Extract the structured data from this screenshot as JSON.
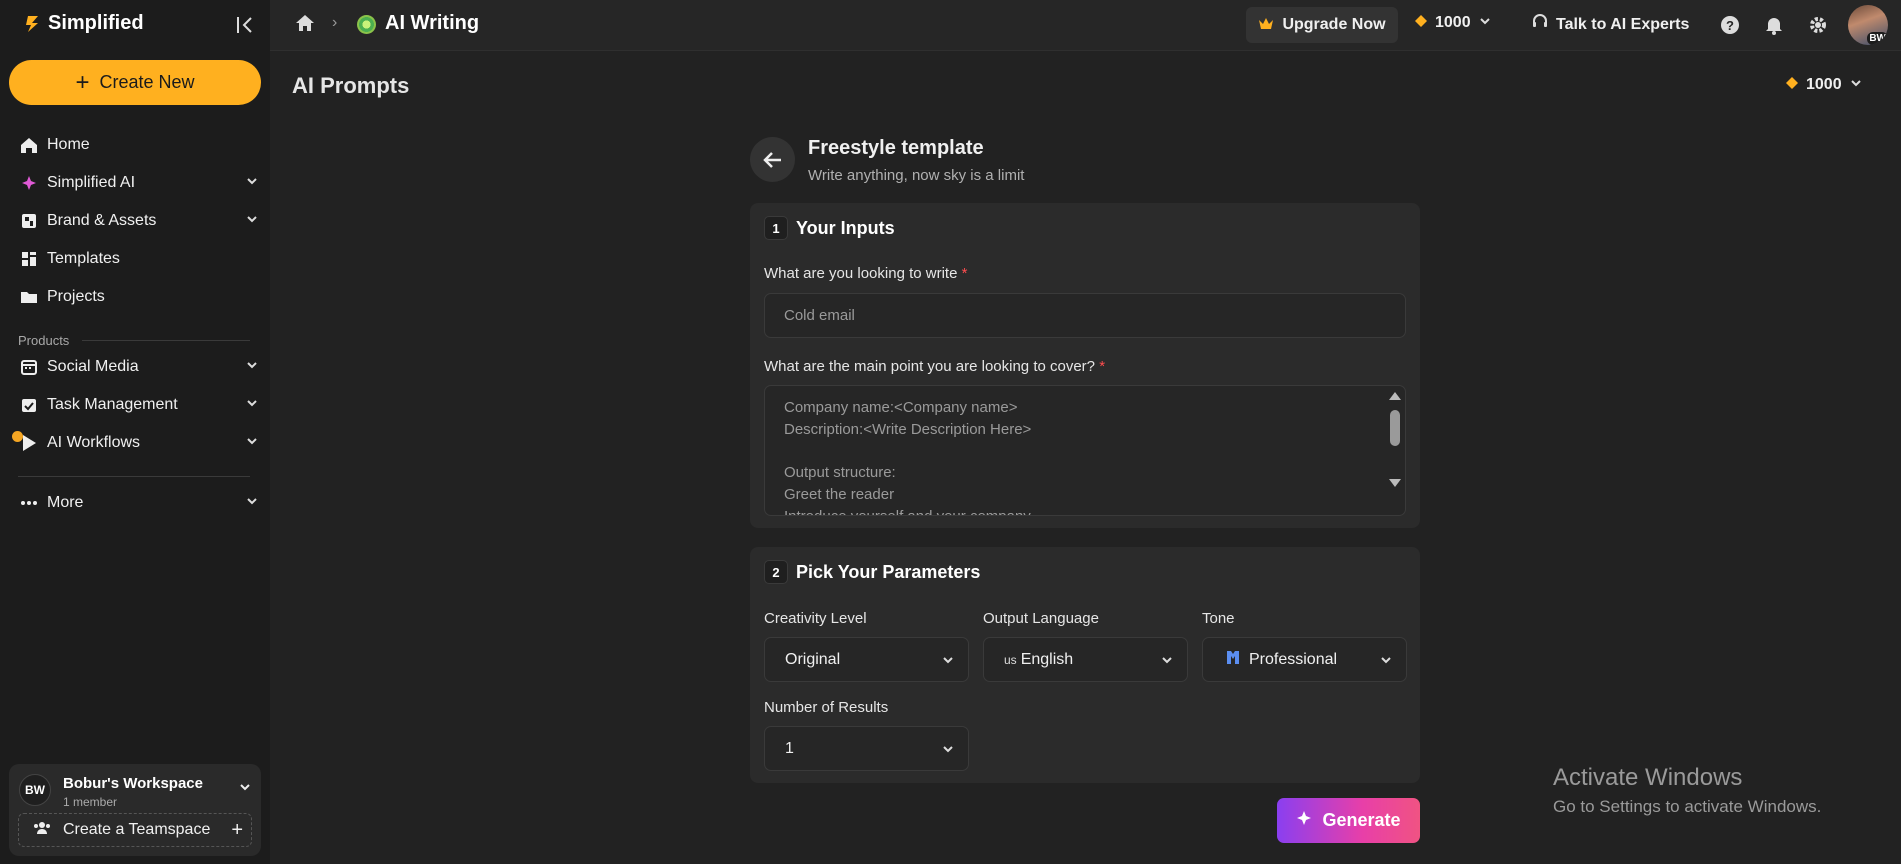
{
  "sidebar": {
    "logo_text": "Simplified",
    "create_label": "Create New",
    "nav_main": [
      {
        "label": "Home",
        "icon": "home-icon"
      },
      {
        "label": "Simplified AI",
        "icon": "sparkle-icon"
      },
      {
        "label": "Brand & Assets",
        "icon": "brand-icon"
      },
      {
        "label": "Templates",
        "icon": "templates-icon"
      },
      {
        "label": "Projects",
        "icon": "folder-icon"
      }
    ],
    "products_label": "Products",
    "nav_products": [
      {
        "label": "Social Media",
        "icon": "calendar-icon"
      },
      {
        "label": "Task Management",
        "icon": "task-icon"
      },
      {
        "label": "AI Workflows",
        "icon": "play-icon"
      }
    ],
    "more_label": "More",
    "workspace": {
      "initials": "BW",
      "name": "Bobur's Workspace",
      "members": "1 member",
      "teamspace_label": "Create a Teamspace"
    }
  },
  "topbar": {
    "app_title": "AI Writing",
    "upgrade_label": "Upgrade Now",
    "credits": "1000",
    "talk_label": "Talk to AI Experts",
    "avatar_initials": "BW"
  },
  "main": {
    "page_title": "AI Prompts",
    "credits": "1000",
    "template_title": "Freestyle template",
    "template_subtitle": "Write anything, now sky is a limit",
    "inputs": {
      "step": "1",
      "title": "Your Inputs",
      "q1_label": "What are you looking to write",
      "q1_placeholder": "Cold email",
      "q2_label": "What are the main point you are looking to cover?",
      "q2_placeholder": "Company name:<Company name>\nDescription:<Write Description Here>\n\nOutput structure:\nGreet the reader\nIntroduce yourself and your company"
    },
    "params": {
      "step": "2",
      "title": "Pick Your Parameters",
      "creativity_label": "Creativity Level",
      "creativity_value": "Original",
      "language_label": "Output Language",
      "language_flag": "us",
      "language_value": "English",
      "tone_label": "Tone",
      "tone_value": "Professional",
      "results_label": "Number of Results",
      "results_value": "1"
    },
    "generate_label": "Generate"
  },
  "overlay": {
    "title": "Activate Windows",
    "subtitle": "Go to Settings to activate Windows."
  },
  "colors": {
    "accent": "#ffb01f",
    "background": "#222222",
    "sidebar": "#1c1c1c",
    "card": "#2b2b2b",
    "generate_gradient_start": "#8a3ff0",
    "generate_gradient_end": "#f05383"
  }
}
